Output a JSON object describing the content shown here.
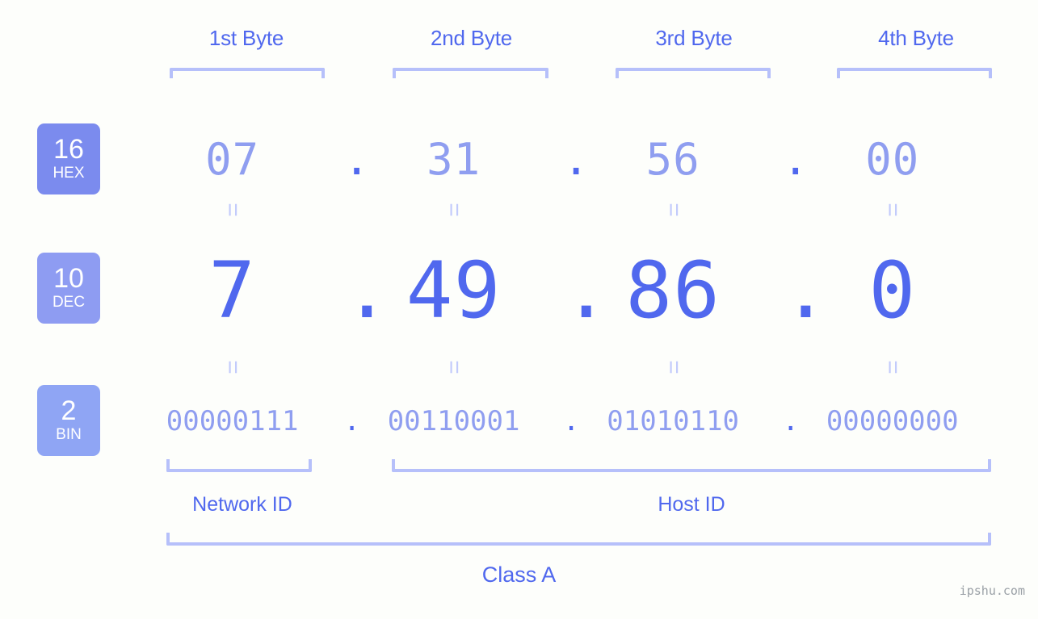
{
  "background_color": "#fdfefb",
  "accent_color": "#5068ee",
  "accent_light_color": "#8f9ef0",
  "bracket_color": "#b6c0fa",
  "equals_color": "#c2cbfb",
  "byte_headers": [
    {
      "label": "1st Byte"
    },
    {
      "label": "2nd Byte"
    },
    {
      "label": "3rd Byte"
    },
    {
      "label": "4th Byte"
    }
  ],
  "rows": [
    {
      "base_number": "16",
      "base_name": "HEX",
      "badge_color": "#7b8bee",
      "values": [
        "07",
        "31",
        "56",
        "00"
      ],
      "separator": "."
    },
    {
      "base_number": "10",
      "base_name": "DEC",
      "badge_color": "#8e9cf2",
      "values": [
        "7",
        "49",
        "86",
        "0"
      ],
      "separator": "."
    },
    {
      "base_number": "2",
      "base_name": "BIN",
      "badge_color": "#8fa5f4",
      "values": [
        "00000111",
        "00110001",
        "01010110",
        "00000000"
      ],
      "separator": "."
    }
  ],
  "equals_symbol": "=",
  "sections": {
    "network_id": "Network ID",
    "host_id": "Host ID"
  },
  "class_label": "Class A",
  "watermark": "ipshu.com"
}
